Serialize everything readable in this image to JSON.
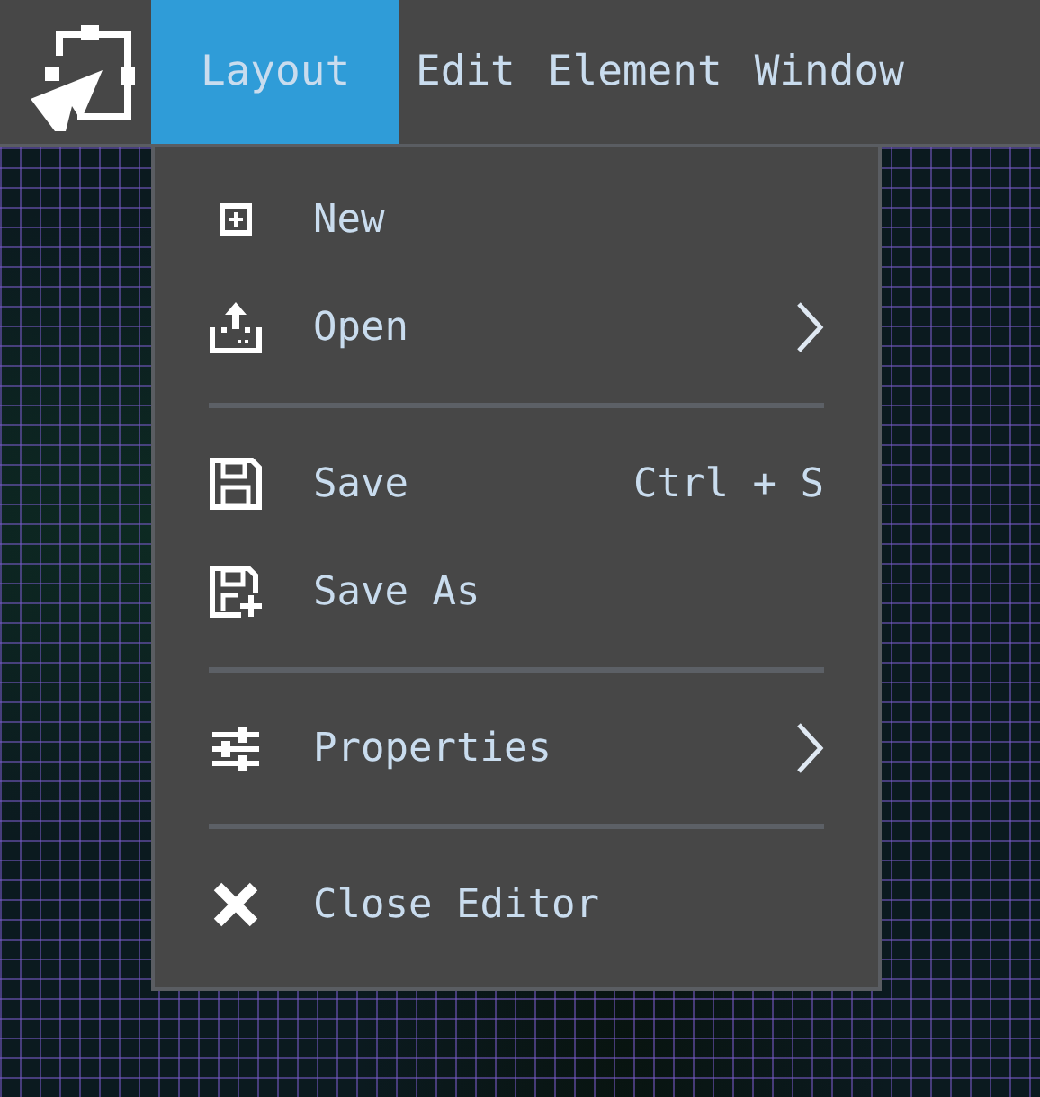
{
  "menu_bar": {
    "tabs": [
      {
        "label": "Layout",
        "selected": true
      },
      {
        "label": "Edit",
        "selected": false
      },
      {
        "label": "Element",
        "selected": false
      },
      {
        "label": "Window",
        "selected": false
      }
    ]
  },
  "dropdown": {
    "items": [
      {
        "kind": "item",
        "label": "New",
        "has_submenu": false
      },
      {
        "kind": "item",
        "label": "Open",
        "has_submenu": true
      },
      {
        "kind": "separator"
      },
      {
        "kind": "item",
        "label": "Save",
        "shortcut": "Ctrl + S",
        "has_submenu": false
      },
      {
        "kind": "item",
        "label": "Save As",
        "has_submenu": false
      },
      {
        "kind": "separator"
      },
      {
        "kind": "item",
        "label": "Properties",
        "has_submenu": true
      },
      {
        "kind": "separator"
      },
      {
        "kind": "item",
        "label": "Close Editor",
        "has_submenu": false
      }
    ]
  }
}
